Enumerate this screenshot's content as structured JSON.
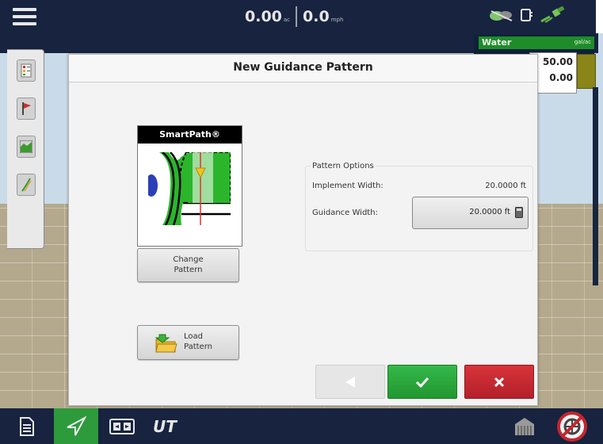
{
  "topbar": {
    "menu_icon": "hamburger-menu-icon",
    "area_value": "0.00",
    "area_unit": "ac",
    "speed_value": "0.0",
    "speed_unit": "mph",
    "status_icons": [
      "seed-status-icon",
      "display-phone-icon",
      "gps-status-icon"
    ]
  },
  "product_panel": {
    "product": "Water",
    "unit": "gal/ac",
    "rate_target": "50.00",
    "rate_applied": "0.00"
  },
  "left_toolbar": {
    "items": [
      "map-layers-icon",
      "flag-icon",
      "field-graph-icon",
      "guidance-line-icon"
    ]
  },
  "dialog": {
    "title": "New Guidance Pattern",
    "pattern": {
      "name": "SmartPath®",
      "image_icon": "smartpath-pattern-icon"
    },
    "change_pattern_label": "Change Pattern",
    "load_pattern_label": "Load Pattern",
    "options": {
      "title": "Pattern Options",
      "implement_width_label": "Implement Width:",
      "implement_width_value": "20.0000 ft",
      "guidance_width_label": "Guidance Width:",
      "guidance_width_value": "20.0000 ft"
    },
    "buttons": {
      "back_icon": "back-arrow-icon",
      "accept_icon": "checkmark-icon",
      "cancel_icon": "close-icon"
    }
  },
  "bottom_bar": {
    "items": [
      "document-icon",
      "guidance-icon",
      "split-screen-icon",
      "ut-icon",
      "implement-icon",
      "no-autosteer-icon"
    ],
    "active": "guidance-icon",
    "ut_label": "UT"
  },
  "colors": {
    "bar": "#17233f",
    "accent_green": "#2d9a3c",
    "confirm_green": "#26a035",
    "cancel_red": "#c4262e",
    "product_green": "#1f8c2a"
  }
}
